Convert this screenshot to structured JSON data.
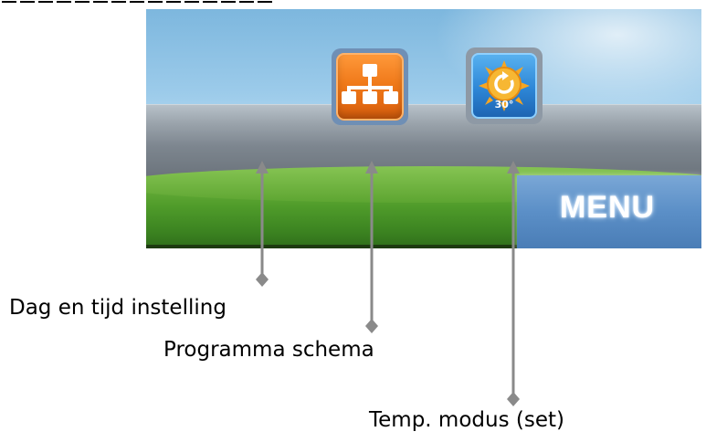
{
  "screen": {
    "program_button": {
      "icon": "network-tree-icon",
      "color": "#f07a1a"
    },
    "temp_button": {
      "icon": "sun-refresh-icon",
      "temp_value": "30°",
      "color": "#2d86d6"
    },
    "menu_button": {
      "label": "MENU",
      "color": "#5b8fc7"
    }
  },
  "callouts": {
    "day_time": "Dag en tijd instelling",
    "program": "Programma schema",
    "temp_mode": "Temp. modus (set)"
  }
}
